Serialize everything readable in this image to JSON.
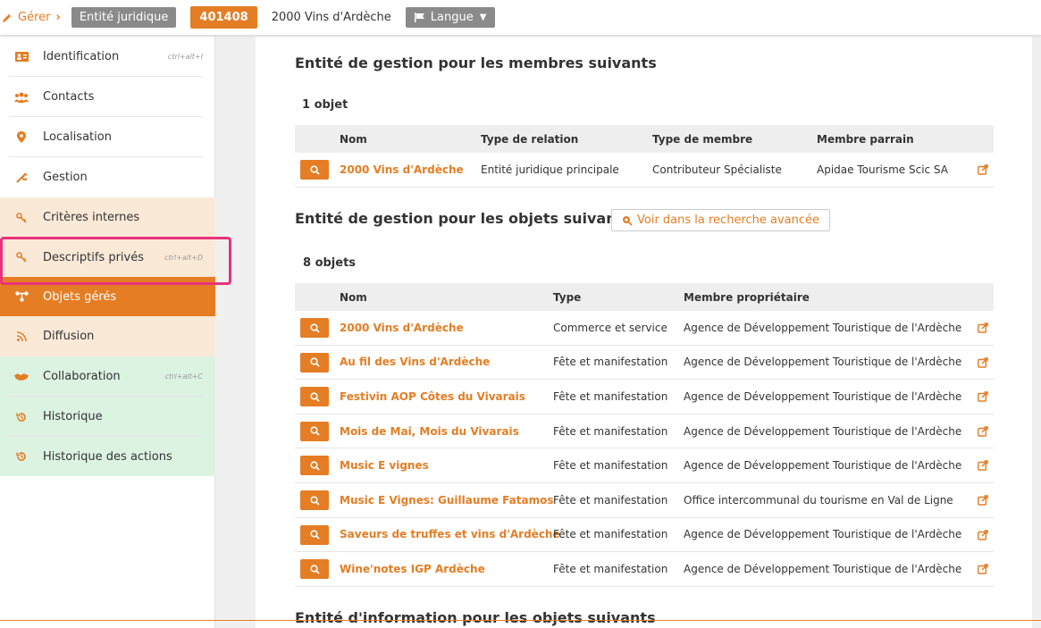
{
  "header": {
    "gerer_label": "Gérer",
    "type_badge": "Entité juridique",
    "id_badge": "401408",
    "entity_name": "2000 Vins d'Ardèche",
    "langue_label": "Langue"
  },
  "sidebar": {
    "items": [
      {
        "label": "Identification",
        "shortcut": "ctrl+alt+I",
        "icon": "id-card-icon"
      },
      {
        "label": "Contacts",
        "shortcut": "",
        "icon": "users-icon"
      },
      {
        "label": "Localisation",
        "shortcut": "",
        "icon": "map-marker-icon"
      },
      {
        "label": "Gestion",
        "shortcut": "",
        "icon": "wrench-icon"
      },
      {
        "label": "Critères internes",
        "shortcut": "",
        "icon": "key-icon"
      },
      {
        "label": "Descriptifs privés",
        "shortcut": "ctrl+alt+D",
        "icon": "key-icon"
      },
      {
        "label": "Objets gérés",
        "shortcut": "",
        "icon": "sitemap-icon"
      },
      {
        "label": "Diffusion",
        "shortcut": "",
        "icon": "rss-icon"
      },
      {
        "label": "Collaboration",
        "shortcut": "ctrl+alt+C",
        "icon": "handshake-icon"
      },
      {
        "label": "Historique",
        "shortcut": "",
        "icon": "history-icon"
      },
      {
        "label": "Historique des actions",
        "shortcut": "",
        "icon": "history-icon"
      }
    ]
  },
  "section1": {
    "title": "Entité de gestion pour les membres suivants",
    "count": "1 objet",
    "headers": [
      "Nom",
      "Type de relation",
      "Type de membre",
      "Membre parrain"
    ],
    "rows": [
      {
        "nom": "2000 Vins d'Ardèche",
        "relation": "Entité juridique principale",
        "membre": "Contributeur Spécialiste",
        "parrain": "Apidae Tourisme Scic SA"
      }
    ]
  },
  "section2": {
    "title": "Entité de gestion pour les objets suivants",
    "button_label": "Voir dans la recherche avancée",
    "count": "8 objets",
    "headers": [
      "Nom",
      "Type",
      "Membre propriétaire"
    ],
    "rows": [
      {
        "nom": "2000 Vins d'Ardèche",
        "type": "Commerce et service",
        "proprio": "Agence de Développement Touristique de l'Ardèche"
      },
      {
        "nom": "Au fil des Vins d'Ardèche",
        "type": "Fête et manifestation",
        "proprio": "Agence de Développement Touristique de l'Ardèche"
      },
      {
        "nom": "Festivin AOP Côtes du Vivarais",
        "type": "Fête et manifestation",
        "proprio": "Agence de Développement Touristique de l'Ardèche"
      },
      {
        "nom": "Mois de Mai, Mois du Vivarais",
        "type": "Fête et manifestation",
        "proprio": "Agence de Développement Touristique de l'Ardèche"
      },
      {
        "nom": "Music E vignes",
        "type": "Fête et manifestation",
        "proprio": "Agence de Développement Touristique de l'Ardèche"
      },
      {
        "nom": "Music E Vignes: Guillaume Fatamos",
        "type": "Fête et manifestation",
        "proprio": "Office intercommunal du tourisme en Val de Ligne"
      },
      {
        "nom": "Saveurs de truffes et vins d'Ardèche",
        "type": "Fête et manifestation",
        "proprio": "Agence de Développement Touristique de l'Ardèche"
      },
      {
        "nom": "Wine'notes IGP Ardèche",
        "type": "Fête et manifestation",
        "proprio": "Agence de Développement Touristique de l'Ardèche"
      }
    ]
  },
  "section3": {
    "title": "Entité d'information pour les objets suivants"
  },
  "colors": {
    "accent": "#e47d24",
    "grey_badge": "#8a8a8a",
    "peach": "#fbe9d8",
    "green": "#dcf3e2",
    "highlight": "#e8337a"
  }
}
